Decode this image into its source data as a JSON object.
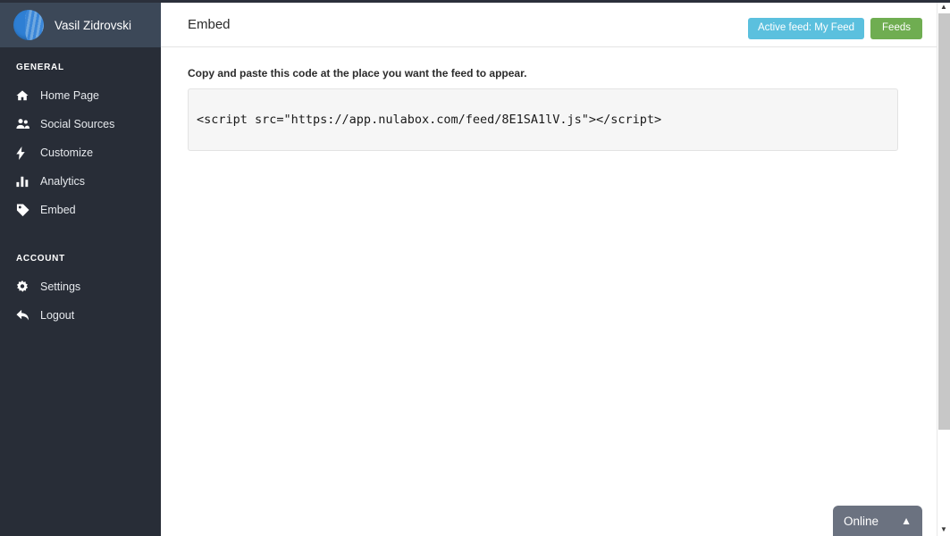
{
  "sidebar": {
    "user": {
      "name": "Vasil Zidrovski",
      "avatar_icon": "user-avatar-sphere"
    },
    "sections": [
      {
        "label": "GENERAL",
        "items": [
          {
            "label": "Home Page",
            "icon": "home-icon"
          },
          {
            "label": "Social Sources",
            "icon": "users-icon"
          },
          {
            "label": "Customize",
            "icon": "bolt-icon"
          },
          {
            "label": "Analytics",
            "icon": "bar-chart-icon"
          },
          {
            "label": "Embed",
            "icon": "tag-icon"
          }
        ]
      },
      {
        "label": "ACCOUNT",
        "items": [
          {
            "label": "Settings",
            "icon": "gear-icon"
          },
          {
            "label": "Logout",
            "icon": "back-arrow-icon"
          }
        ]
      }
    ]
  },
  "header": {
    "title": "Embed",
    "active_feed_button": "Active feed: My Feed",
    "feeds_button": "Feeds",
    "colors": {
      "active_feed": "#5bc0de",
      "feeds": "#6fad51"
    }
  },
  "main": {
    "instruction": "Copy and paste this code at the place you want the feed to appear.",
    "embed_code": "<script src=\"https://app.nulabox.com/feed/8E1SA1lV.js\"></script>"
  },
  "chat": {
    "status_label": "Online",
    "caret_icon": "chevron-up-icon"
  },
  "scrollbar": {
    "up_arrow_icon": "scroll-up-arrow-icon",
    "down_arrow_icon": "scroll-down-arrow-icon"
  }
}
